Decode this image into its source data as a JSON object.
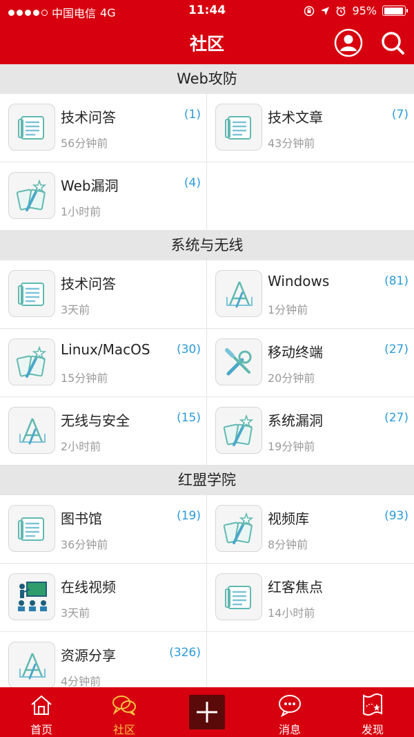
{
  "status_bar": {
    "carrier": "中国电信",
    "network": "4G",
    "time": "11:44",
    "battery": "95%",
    "battery_level": 0.95
  },
  "nav": {
    "title": "社区"
  },
  "sections": [
    {
      "title": "Web攻防",
      "items": [
        {
          "title": "技术问答",
          "time": "56分钟前",
          "count": "(1)",
          "icon": "newspaper-icon"
        },
        {
          "title": "技术文章",
          "time": "43分钟前",
          "count": "(7)",
          "icon": "newspaper-icon"
        },
        {
          "title": "Web漏洞",
          "time": "1小时前",
          "count": "(4)",
          "icon": "magic-wand-icon"
        }
      ]
    },
    {
      "title": "系统与无线",
      "items": [
        {
          "title": "技术问答",
          "time": "3天前",
          "count": "",
          "icon": "newspaper-icon"
        },
        {
          "title": "Windows",
          "time": "1分钟前",
          "count": "(81)",
          "icon": "app-store-icon"
        },
        {
          "title": "Linux/MacOS",
          "time": "15分钟前",
          "count": "(30)",
          "icon": "magic-wand-icon"
        },
        {
          "title": "移动终端",
          "time": "20分钟前",
          "count": "(27)",
          "icon": "wrench-icon"
        },
        {
          "title": "无线与安全",
          "time": "2小时前",
          "count": "(15)",
          "icon": "app-store-icon"
        },
        {
          "title": "系统漏洞",
          "time": "19分钟前",
          "count": "(27)",
          "icon": "magic-wand-icon"
        }
      ]
    },
    {
      "title": "红盟学院",
      "items": [
        {
          "title": "图书馆",
          "time": "36分钟前",
          "count": "(19)",
          "icon": "newspaper-icon"
        },
        {
          "title": "视频库",
          "time": "8分钟前",
          "count": "(93)",
          "icon": "magic-wand-icon"
        },
        {
          "title": "在线视频",
          "time": "3天前",
          "count": "",
          "icon": "classroom-icon"
        },
        {
          "title": "红客焦点",
          "time": "14小时前",
          "count": "",
          "icon": "newspaper-icon"
        },
        {
          "title": "资源分享",
          "time": "4分钟前",
          "count": "(326)",
          "icon": "app-store-icon"
        }
      ]
    }
  ],
  "tabbar": {
    "items": [
      {
        "label": "首页",
        "icon": "home-icon",
        "active": false
      },
      {
        "label": "社区",
        "icon": "chat-bubbles-icon",
        "active": true
      },
      {
        "label": "",
        "icon": "plus-icon",
        "active": false
      },
      {
        "label": "消息",
        "icon": "message-icon",
        "active": false
      },
      {
        "label": "发现",
        "icon": "map-flag-icon",
        "active": false
      }
    ]
  },
  "colors": {
    "brand_red": "#d7000f",
    "count_blue": "#2a9ad8",
    "active_tab": "#f4c542",
    "icon_teal": "#5fb8b0"
  }
}
